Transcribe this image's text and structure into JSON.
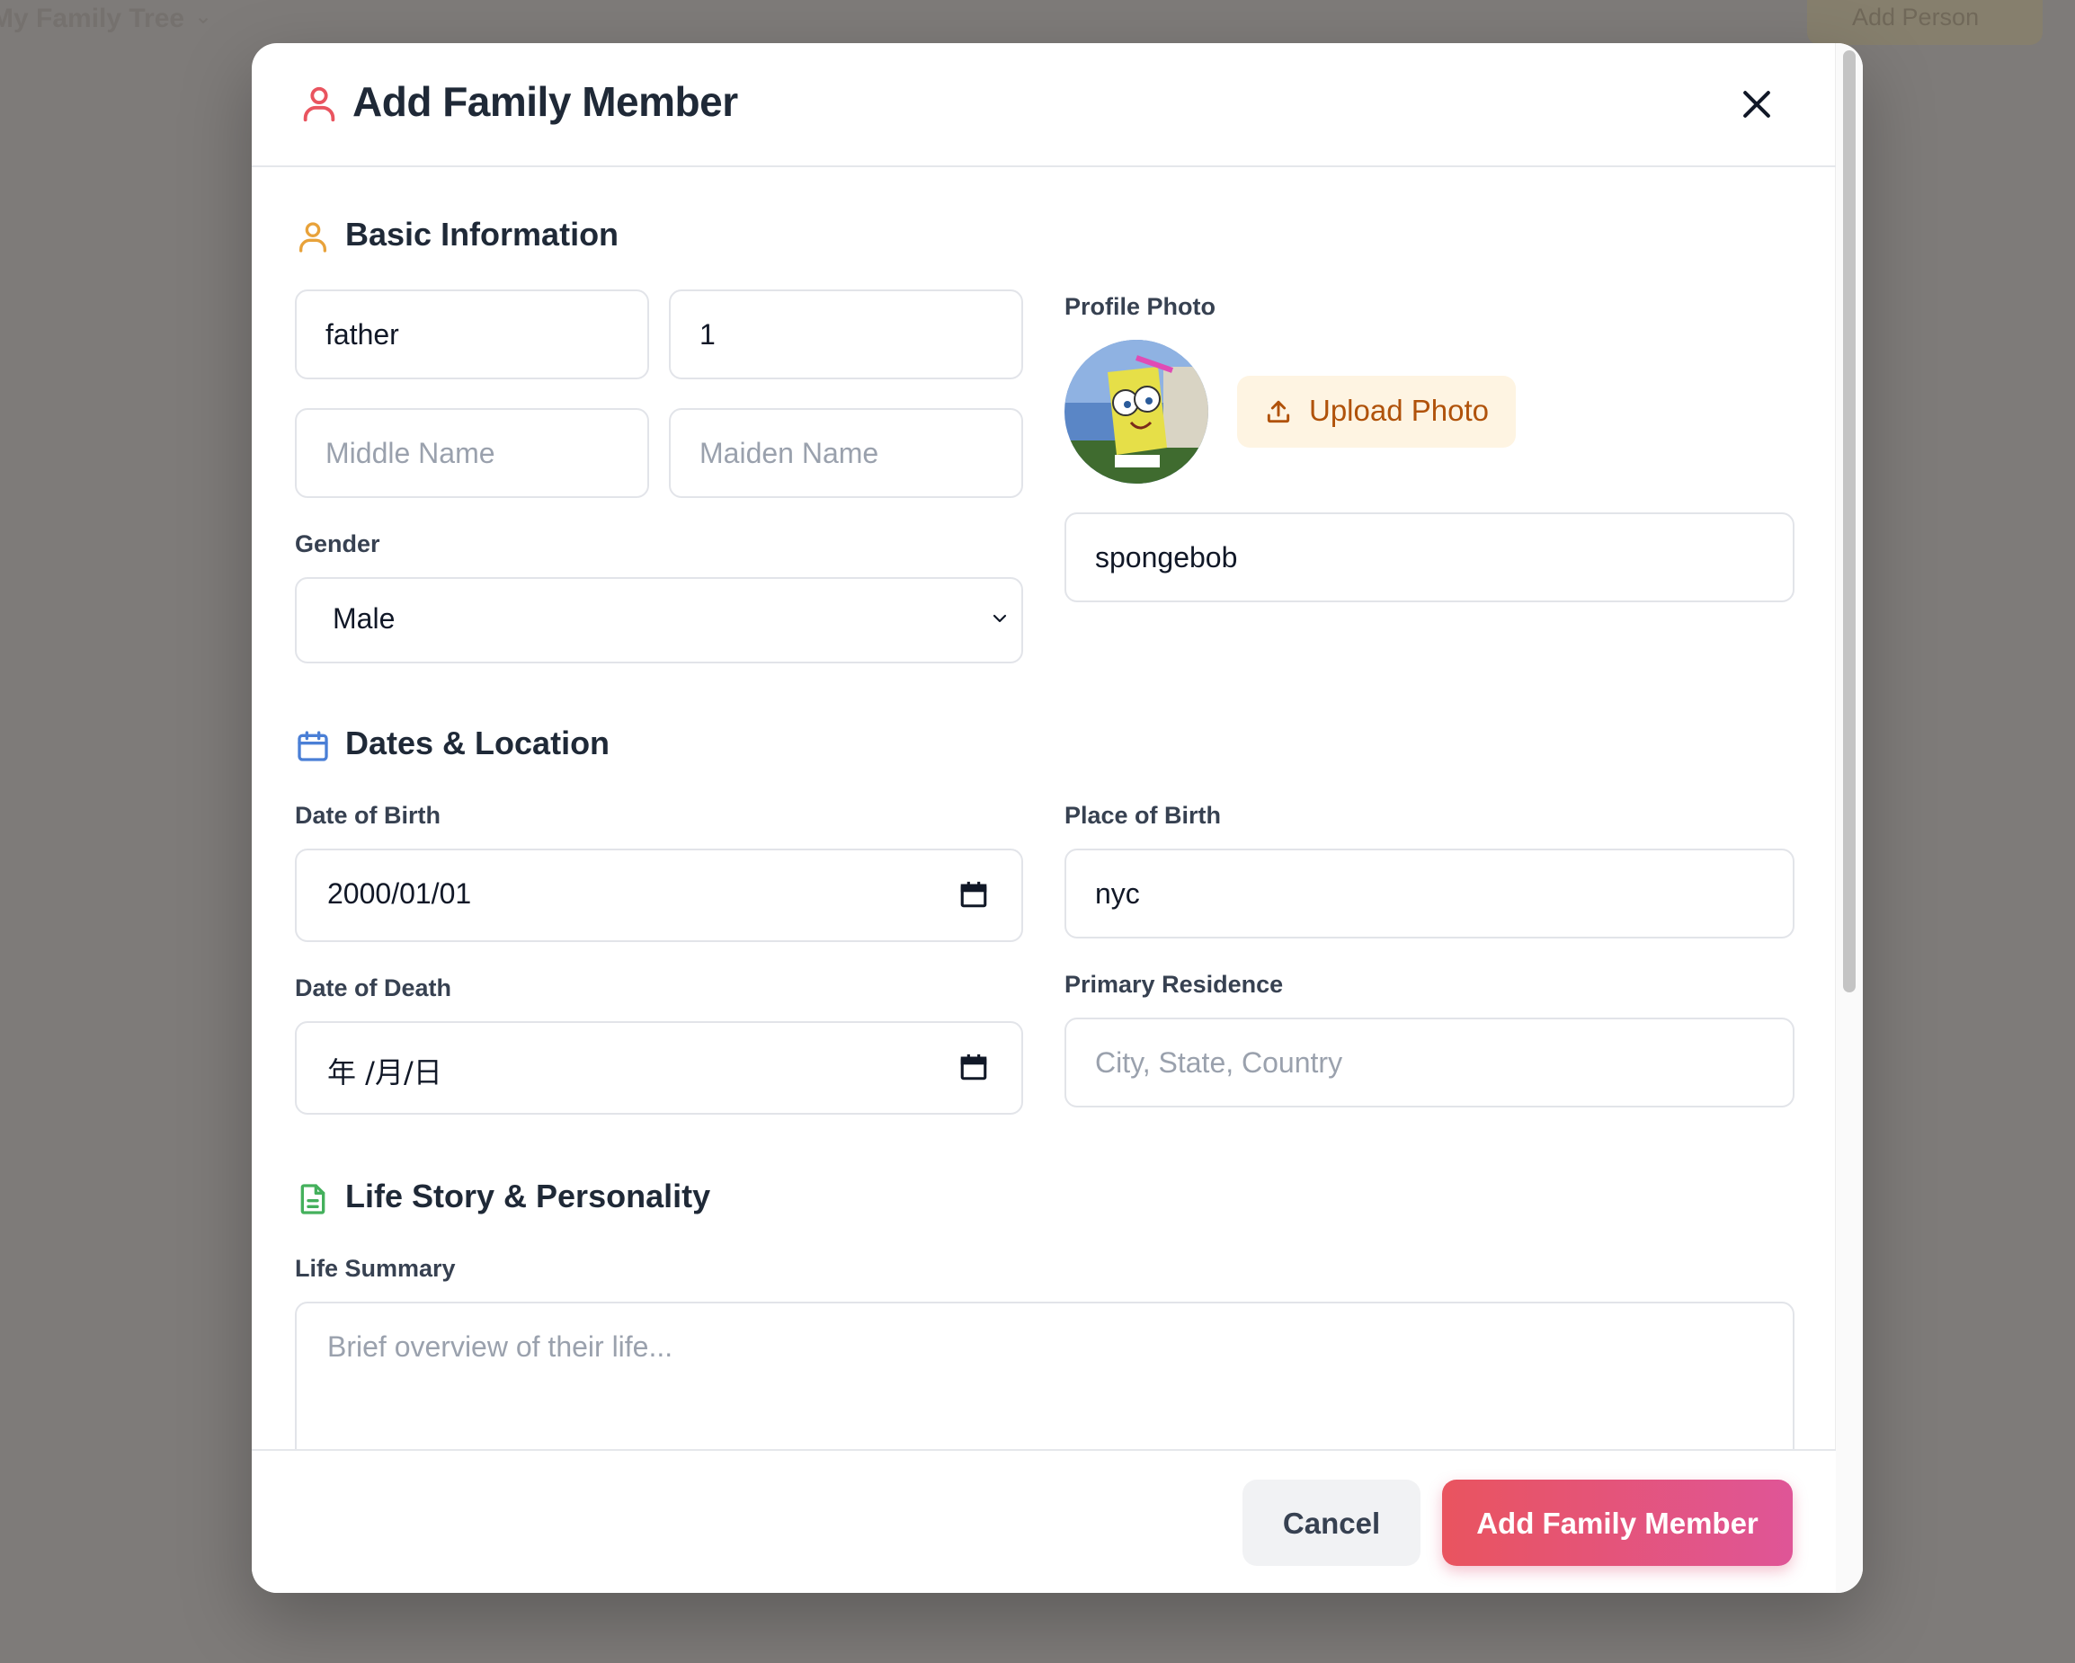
{
  "background": {
    "app_title": "My Family Tree",
    "add_person_label": "Add Person"
  },
  "modal": {
    "title": "Add Family Member",
    "close_icon": "x-icon"
  },
  "basic_info": {
    "heading": "Basic Information",
    "first_name_value": "father",
    "last_name_value": "1",
    "middle_name_placeholder": "Middle Name",
    "maiden_name_placeholder": "Maiden Name",
    "gender_label": "Gender",
    "gender_value": "Male",
    "profile_photo_label": "Profile Photo",
    "upload_label": "Upload Photo",
    "nickname_value": "spongebob"
  },
  "dates_location": {
    "heading": "Dates & Location",
    "dob_label": "Date of Birth",
    "dob_value": "2000/01/01",
    "pob_label": "Place of Birth",
    "pob_value": "nyc",
    "dod_label": "Date of Death",
    "dod_value": "年 /月/日",
    "residence_label": "Primary Residence",
    "residence_placeholder": "City, State, Country"
  },
  "life_story": {
    "heading": "Life Story & Personality",
    "summary_label": "Life Summary",
    "summary_placeholder": "Brief overview of their life..."
  },
  "footer": {
    "cancel_label": "Cancel",
    "submit_label": "Add Family Member"
  },
  "colors": {
    "accent": "#e9545f",
    "accent_end": "#df5597",
    "basic_icon": "#e8a23a",
    "dates_icon": "#4a7fd6",
    "story_icon": "#44b05c",
    "upload_text": "#b0520a",
    "upload_bg": "#fef4e2"
  }
}
